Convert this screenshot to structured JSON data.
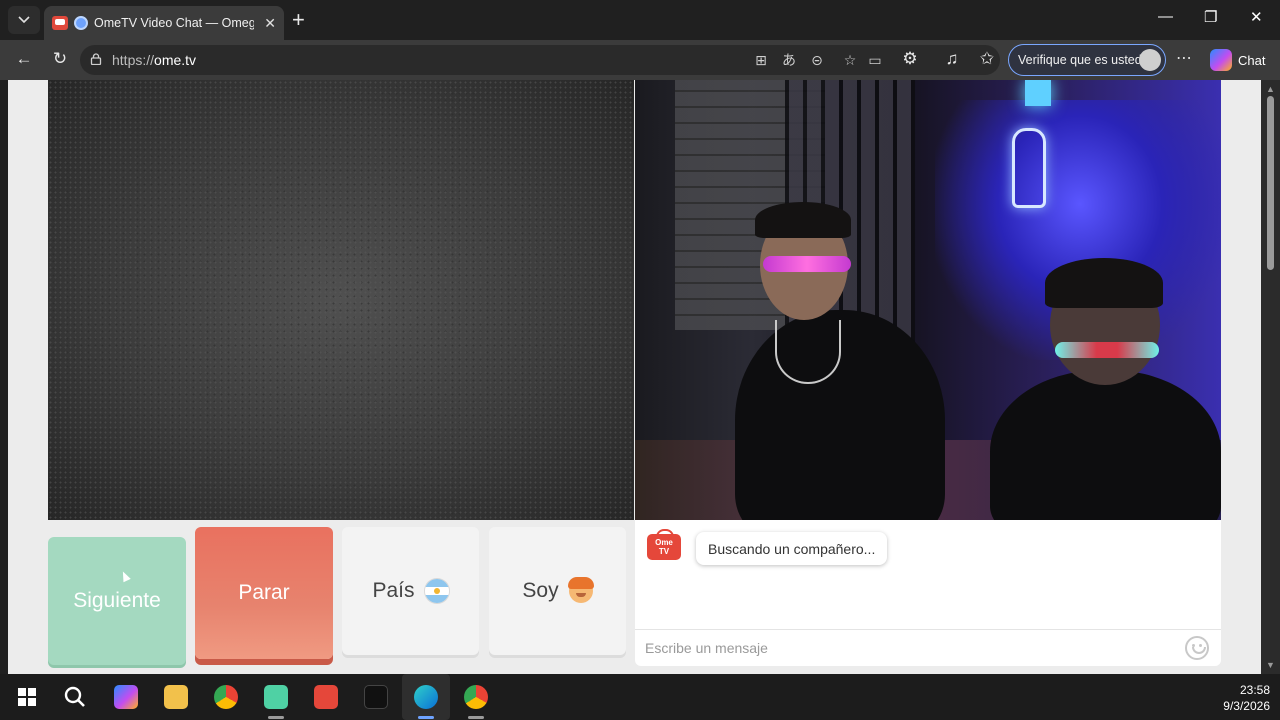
{
  "browser": {
    "tab_title": "OmeTV Video Chat — Omegle",
    "url_prefix": "https://",
    "url_host": "ome.tv",
    "verify_label": "Verifique que es usted",
    "copilot_label": "Chat"
  },
  "controls": {
    "next_label": "Siguiente",
    "stop_label": "Parar",
    "country_label": "País",
    "country_flag": "argentina-flag",
    "gender_label": "Soy",
    "gender_icon": "boy-icon"
  },
  "chat": {
    "status_message": "Buscando un compañero...",
    "logo_text_top": "Ome",
    "logo_text_bottom": "TV",
    "input_placeholder": "Escribe un mensaje"
  },
  "taskbar": {
    "time": "23:58",
    "date": "9/3/2026"
  },
  "colors": {
    "next_button": "#a4d9c0",
    "stop_button": "#e8775f",
    "brand_red": "#e5473a"
  }
}
